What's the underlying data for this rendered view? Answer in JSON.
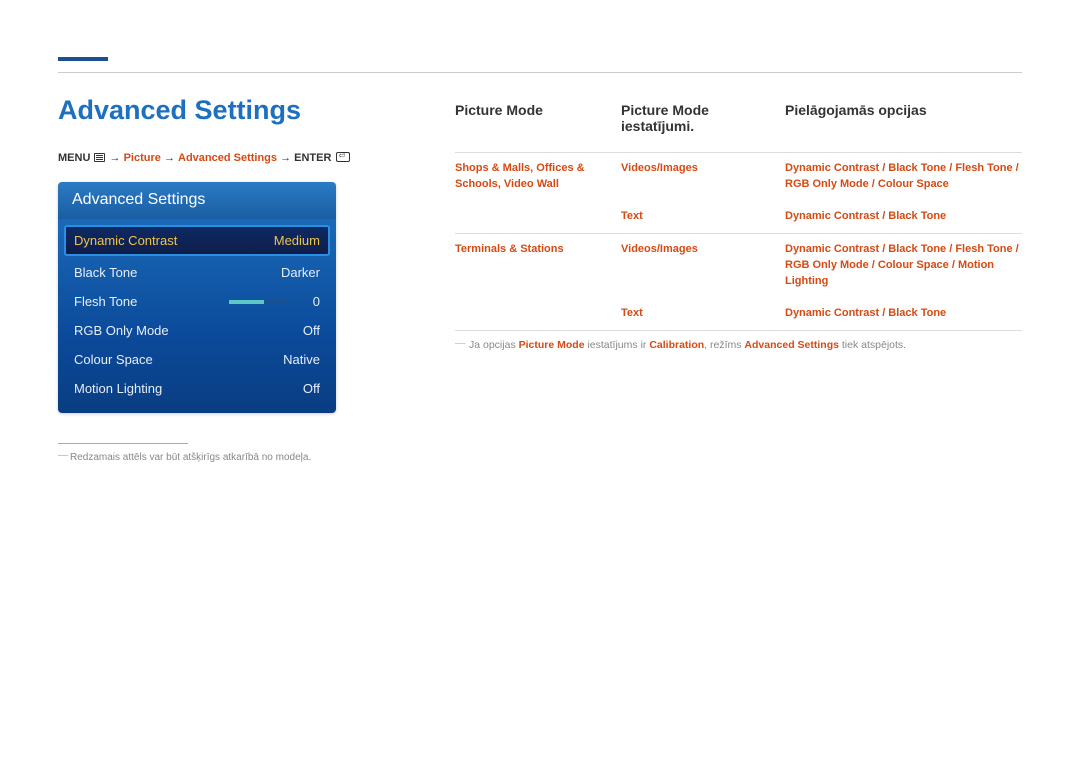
{
  "page_title": "Advanced Settings",
  "breadcrumb": {
    "menu": "MENU",
    "arrow": "→",
    "picture": "Picture",
    "advanced": "Advanced Settings",
    "enter": "ENTER"
  },
  "osd": {
    "title": "Advanced Settings",
    "rows": [
      {
        "label": "Dynamic Contrast",
        "value": "Medium",
        "selected": true
      },
      {
        "label": "Black Tone",
        "value": "Darker"
      },
      {
        "label": "Flesh Tone",
        "value": "0",
        "slider": true
      },
      {
        "label": "RGB Only Mode",
        "value": "Off"
      },
      {
        "label": "Colour Space",
        "value": "Native"
      },
      {
        "label": "Motion Lighting",
        "value": "Off"
      }
    ]
  },
  "footnote": "Redzamais attēls var būt atšķirīgs atkarībā no modeļa.",
  "table": {
    "headers": {
      "h1": "Picture Mode",
      "h2": "Picture Mode iestatījumi.",
      "h3": "Pielāgojamās opcijas"
    },
    "rows": [
      {
        "mode": "Shops & Malls, Offices & Schools, Video Wall",
        "setting": "Videos/Images",
        "opts": "Dynamic Contrast / Black Tone / Flesh Tone / RGB Only Mode / Colour Space"
      },
      {
        "mode": "",
        "setting": "Text",
        "opts": "Dynamic Contrast / Black Tone"
      },
      {
        "mode": "Terminals & Stations",
        "setting": "Videos/Images",
        "opts": "Dynamic Contrast / Black Tone / Flesh Tone / RGB Only Mode / Colour Space / Motion Lighting"
      },
      {
        "mode": "",
        "setting": "Text",
        "opts": "Dynamic Contrast / Black Tone"
      }
    ]
  },
  "note": {
    "p1": "Ja opcijas ",
    "pm": "Picture Mode",
    "p2": " iestatījums ir ",
    "cal": "Calibration",
    "p3": ", režīms ",
    "as": "Advanced Settings",
    "p4": " tiek atspējots."
  }
}
